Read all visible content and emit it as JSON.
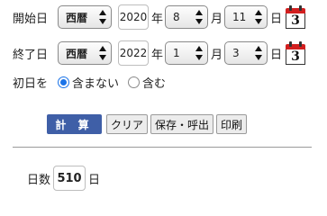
{
  "start": {
    "label": "開始日",
    "era": "西暦",
    "year": "2020",
    "year_unit": "年",
    "month": "8",
    "month_unit": "月",
    "day": "11",
    "day_unit": "日",
    "calendar_icon_digit": "3"
  },
  "end": {
    "label": "終了日",
    "era": "西暦",
    "year": "2022",
    "year_unit": "年",
    "month": "1",
    "month_unit": "月",
    "day": "3",
    "day_unit": "日",
    "calendar_icon_digit": "3"
  },
  "first_day": {
    "label": "初日を",
    "options": [
      {
        "label": "含まない",
        "selected": true
      },
      {
        "label": "含む",
        "selected": false
      }
    ]
  },
  "buttons": {
    "calculate": "計 算",
    "clear": "クリア",
    "save_load": "保存・呼出",
    "print": "印刷"
  },
  "result": {
    "label": "日数",
    "value": "510",
    "unit": "日"
  },
  "colors": {
    "primary_button": "#3f5fa7",
    "radio_accent": "#1a73e8",
    "calendar_red": "#d21f1f"
  }
}
